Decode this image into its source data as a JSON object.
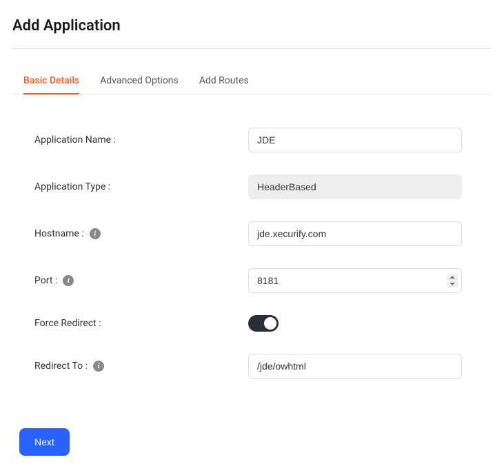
{
  "page": {
    "title": "Add Application"
  },
  "tabs": {
    "basic": "Basic Details",
    "advanced": "Advanced Options",
    "routes": "Add Routes"
  },
  "form": {
    "appName": {
      "label": "Application Name :",
      "value": "JDE"
    },
    "appType": {
      "label": "Application Type :",
      "value": "HeaderBased"
    },
    "hostname": {
      "label": "Hostname :",
      "value": "jde.xecurify.com"
    },
    "port": {
      "label": "Port :",
      "value": "8181"
    },
    "forceRedirect": {
      "label": "Force Redirect :",
      "enabled": true
    },
    "redirectTo": {
      "label": "Redirect To :",
      "value": "/jde/owhtml"
    }
  },
  "buttons": {
    "next": "Next"
  }
}
